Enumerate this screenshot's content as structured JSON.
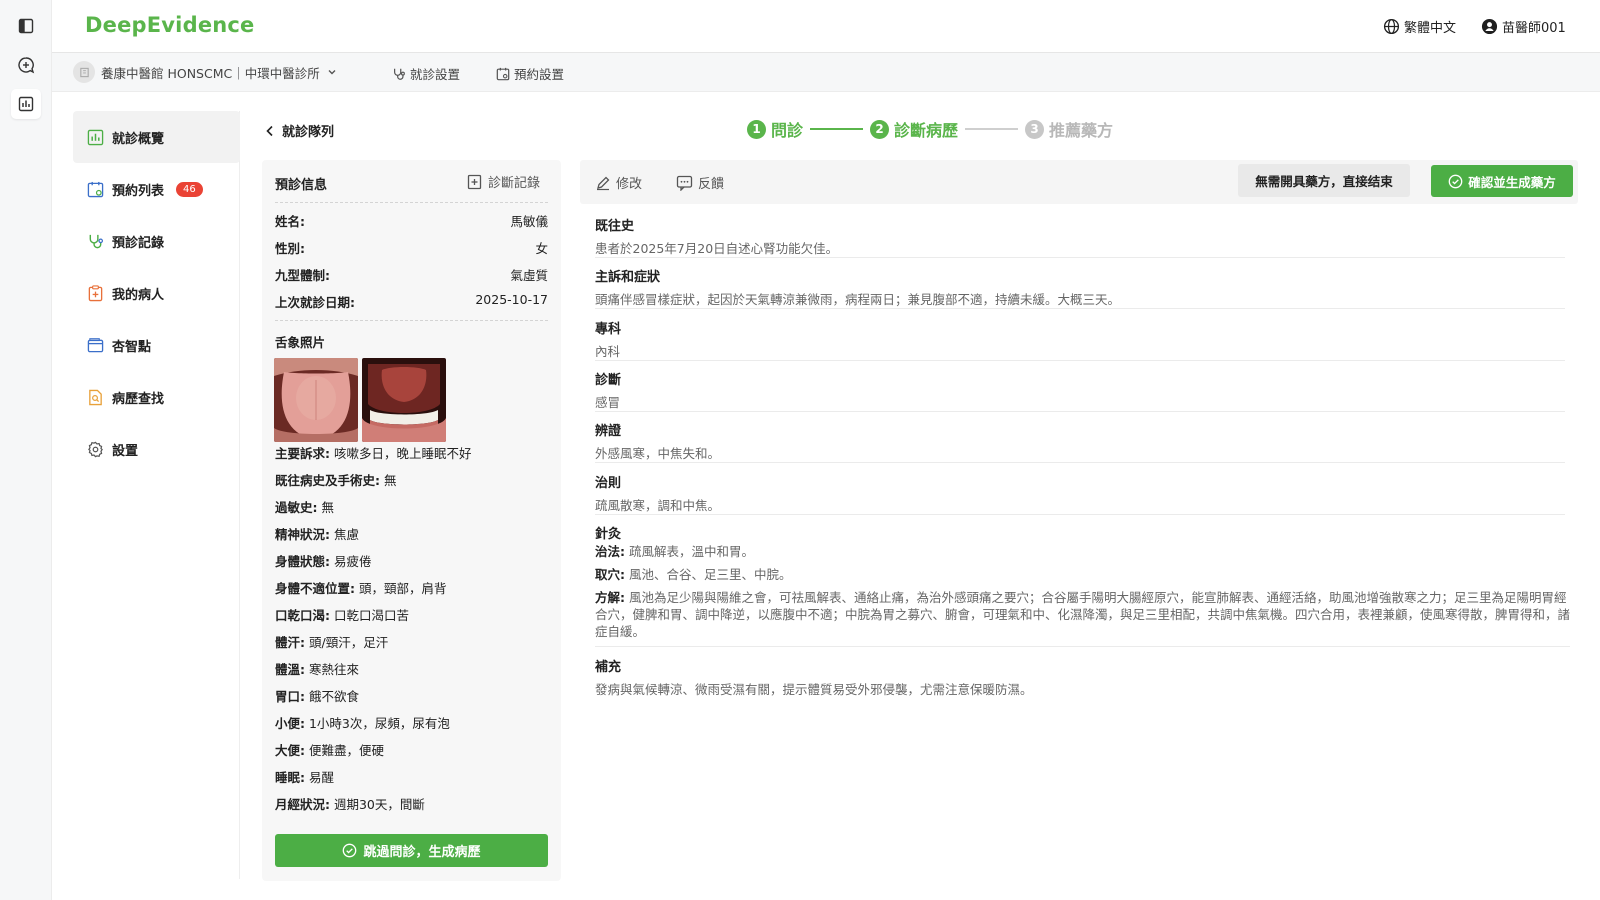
{
  "app": {
    "logo": "DeepEvidence",
    "language": "繁體中文",
    "user": "苗醫師001"
  },
  "subbar": {
    "clinic": "養康中醫館 HONSCMC｜中環中醫診所",
    "links": [
      "就診設置",
      "預約設置"
    ]
  },
  "nav": {
    "items": [
      {
        "label": "就診概覽",
        "icon": "bar-chart-icon",
        "active": true
      },
      {
        "label": "預約列表",
        "icon": "calendar-icon",
        "badge": "46"
      },
      {
        "label": "預診記錄",
        "icon": "stethoscope-icon"
      },
      {
        "label": "我的病人",
        "icon": "clipboard-icon"
      },
      {
        "label": "杏智點",
        "icon": "wallet-icon"
      },
      {
        "label": "病歷查找",
        "icon": "search-file-icon"
      },
      {
        "label": "設置",
        "icon": "gear-icon"
      }
    ]
  },
  "back": {
    "label": "就診隊列"
  },
  "steps": [
    {
      "num": "1",
      "label": "問診",
      "state": "done"
    },
    {
      "num": "2",
      "label": "診斷病歷",
      "state": "done"
    },
    {
      "num": "3",
      "label": "推薦藥方",
      "state": "todo"
    }
  ],
  "pre": {
    "title": "預診信息",
    "record_label": "診斷記錄",
    "fields": [
      {
        "k": "姓名:",
        "v": "馬敏儀"
      },
      {
        "k": "性別:",
        "v": "女"
      },
      {
        "k": "九型體制:",
        "v": "氣虛質"
      },
      {
        "k": "上次就診日期:",
        "v": "2025-10-17"
      }
    ],
    "tongue_title": "舌象照片",
    "symptoms": [
      {
        "k": "主要訴求:",
        "v": "咳嗽多日，晚上睡眠不好"
      },
      {
        "k": "既往病史及手術史:",
        "v": "無"
      },
      {
        "k": "過敏史:",
        "v": "無"
      },
      {
        "k": "精神狀況:",
        "v": "焦慮"
      },
      {
        "k": "身體狀態:",
        "v": "易疲倦"
      },
      {
        "k": "身體不適位置:",
        "v": "頭，頸部，肩背"
      },
      {
        "k": "口乾口渴:",
        "v": "口乾口渴口苦"
      },
      {
        "k": "體汗:",
        "v": "頭/頸汗，足汗"
      },
      {
        "k": "體溫:",
        "v": "寒熱往來"
      },
      {
        "k": "胃口:",
        "v": "餓不欲食"
      },
      {
        "k": "小便:",
        "v": "1小時3次，尿頻，尿有泡"
      },
      {
        "k": "大便:",
        "v": "便難盡，便硬"
      },
      {
        "k": "睡眠:",
        "v": "易醒"
      },
      {
        "k": "月經狀況:",
        "v": "週期30天，間斷"
      }
    ],
    "skip_button": "跳過問診，生成病歷"
  },
  "toolbar": {
    "edit": "修改",
    "feedback": "反饋",
    "no_prescription": "無需開具藥方，直接结束",
    "confirm": "確認並生成藥方"
  },
  "record": {
    "sections": [
      {
        "title": "既往史",
        "text": "患者於2025年7月20日自述心腎功能欠佳。"
      },
      {
        "title": "主訴和症狀",
        "text": "頭痛伴感冒樣症狀，起因於天氣轉涼兼微雨，病程兩日；兼見腹部不適，持續未緩。大概三天。"
      },
      {
        "title": "專科",
        "text": "內科"
      },
      {
        "title": "診斷",
        "text": "感冒"
      },
      {
        "title": "辨證",
        "text": "外感風寒，中焦失和。"
      },
      {
        "title": "治則",
        "text": "疏風散寒，調和中焦。"
      }
    ],
    "acupuncture": {
      "title": "針灸",
      "method_label": "治法:",
      "method": "疏風解表，溫中和胃。",
      "points_label": "取穴:",
      "points": "風池、合谷、足三里、中脘。",
      "formula_label": "方解:",
      "formula": "風池為足少陽與陽維之會，可祛風解表、通絡止痛，為治外感頭痛之要穴；合谷屬手陽明大腸經原穴，能宣肺解表、通經活絡，助風池增強散寒之力；足三里為足陽明胃經合穴，健脾和胃、調中降逆，以應腹中不適；中脘為胃之募穴、腑會，可理氣和中、化濕降濁，與足三里相配，共調中焦氣機。四穴合用，表裡兼顧，使風寒得散，脾胃得和，諸症自緩。"
    },
    "supplement": {
      "title": "補充",
      "text": "發病與氣候轉涼、微雨受濕有關，提示體質易受外邪侵襲，尤需注意保暖防濕。"
    }
  },
  "colors": {
    "accent": "#5ab54b",
    "badge": "#ea4335"
  }
}
